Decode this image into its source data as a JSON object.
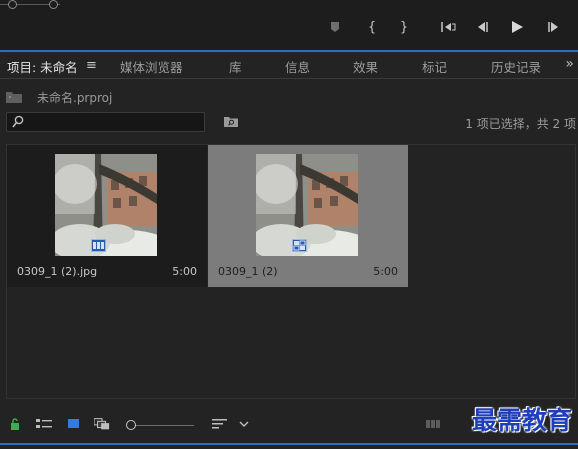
{
  "tabs": [
    {
      "label": "项目: 未命名"
    },
    {
      "label": "媒体浏览器"
    },
    {
      "label": "库"
    },
    {
      "label": "信息"
    },
    {
      "label": "效果"
    },
    {
      "label": "标记"
    },
    {
      "label": "历史记录"
    }
  ],
  "tabs_more": "»",
  "tab_menu": "≡",
  "project": {
    "name": "未命名.prproj"
  },
  "search": {
    "value": "",
    "placeholder": ""
  },
  "status": {
    "selection": "1 项已选择，共 2 项"
  },
  "clips": [
    {
      "name": "0309_1 (2).jpg",
      "duration": "5:00",
      "selected": false,
      "badge": "image-clip-icon"
    },
    {
      "name": "0309_1 (2)",
      "duration": "5:00",
      "selected": true,
      "badge": "sequence-icon"
    }
  ],
  "zoom": {
    "level": 0.0
  },
  "watermark": {
    "text": "最需教育"
  },
  "colors": {
    "accent": "#2c6fc0",
    "selected_bg": "#7c7c7c",
    "lock_green": "#3fae49",
    "icon_blue": "#2f7de0"
  }
}
